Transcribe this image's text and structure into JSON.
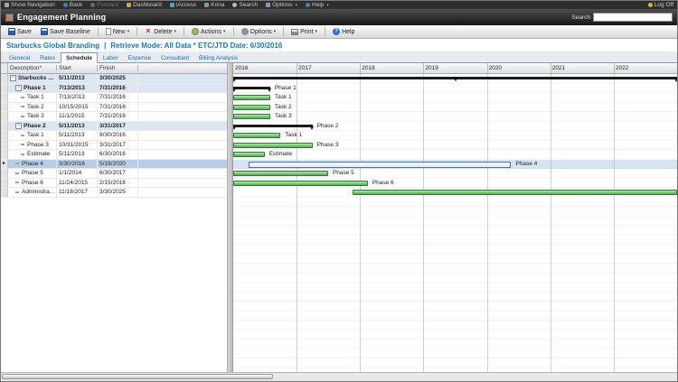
{
  "colors": {
    "accent_text": "#1b78a8",
    "summary_row_bg": "#dce6f3",
    "selection_bg": "#b7cde9",
    "bar_green_light": "#b9e3b3",
    "bar_green": "#53ab53",
    "bar_green_border": "#2e7a2e",
    "summary_bar": "#1a1a1a",
    "selected_bar_border": "#4a72a0",
    "selected_bar_fill": "#dfeaf4"
  },
  "utility_bar": {
    "items": [
      {
        "label": "Show Navigation",
        "icon": "show-navigation-icon",
        "disabled": false,
        "dropdown": false
      },
      {
        "label": "Back",
        "icon": "back-icon",
        "disabled": false,
        "dropdown": false
      },
      {
        "label": "Forward",
        "icon": "forward-icon",
        "disabled": true,
        "dropdown": false
      },
      {
        "label": "Dashboard",
        "icon": "dashboard-icon",
        "disabled": false,
        "dropdown": false
      },
      {
        "label": "iAccess",
        "icon": "iaccess-icon",
        "disabled": false,
        "dropdown": false
      },
      {
        "label": "Kona",
        "icon": "kona-icon",
        "disabled": false,
        "dropdown": false
      },
      {
        "label": "Search",
        "icon": "search-glyph-icon",
        "disabled": false,
        "dropdown": false
      },
      {
        "label": "Options",
        "icon": "options-icon",
        "disabled": false,
        "dropdown": true
      },
      {
        "label": "Help",
        "icon": "help-icon",
        "disabled": false,
        "dropdown": true
      }
    ],
    "log_off_label": "Log Off"
  },
  "title_bar": {
    "title": "Engagement Planning",
    "search_label": "Search",
    "search_value": ""
  },
  "toolbar": {
    "buttons": [
      {
        "label": "Save",
        "icon": "save-icon",
        "dropdown": false,
        "group_end": false
      },
      {
        "label": "Save Baseline",
        "icon": "save-baseline-icon",
        "dropdown": false,
        "group_end": true
      },
      {
        "label": "New",
        "icon": "new-icon",
        "dropdown": true,
        "group_end": true
      },
      {
        "label": "Delete",
        "icon": "delete-icon",
        "dropdown": true,
        "group_end": true
      },
      {
        "label": "Actions",
        "icon": "actions-icon",
        "dropdown": true,
        "group_end": true
      },
      {
        "label": "Options",
        "icon": "options-gear-icon",
        "dropdown": true,
        "group_end": true
      },
      {
        "label": "Print",
        "icon": "print-icon",
        "dropdown": true,
        "group_end": true
      },
      {
        "label": "Help",
        "icon": "help-circle-icon",
        "dropdown": false,
        "group_end": false
      }
    ]
  },
  "info_bar": {
    "project_name": "Starbucks Global Branding",
    "separator": "|",
    "retrieve_mode": "Retrieve Mode: All Data * ETC/JTD Date: 6/30/2016"
  },
  "tabs": {
    "selected": "Schedule",
    "items": [
      "General",
      "Rates",
      "Schedule",
      "Labor",
      "Expense",
      "Consultant",
      "Billing Analysis"
    ]
  },
  "grid": {
    "columns": [
      "Description*",
      "Start",
      "Finish"
    ],
    "rows": [
      {
        "indent": 0,
        "toggle": "-",
        "name": "Starbucks Glob...",
        "start": "5/11/2013",
        "finish": "3/30/2025",
        "style": "summary",
        "bar": "summary",
        "bar_label": "",
        "selected": false
      },
      {
        "indent": 1,
        "toggle": "-",
        "name": "Phase 1",
        "start": "7/13/2013",
        "finish": "7/31/2016",
        "style": "summary",
        "bar": "summary",
        "bar_label": "Phase 1",
        "selected": false
      },
      {
        "indent": 2,
        "toggle": "",
        "name": "Task 1",
        "start": "7/13/2013",
        "finish": "7/31/2016",
        "style": "normal",
        "bar": "task",
        "bar_label": "Task 1",
        "selected": false
      },
      {
        "indent": 2,
        "toggle": "",
        "name": "Task 2",
        "start": "10/15/2015",
        "finish": "7/31/2016",
        "style": "normal",
        "bar": "task",
        "bar_label": "Task 2",
        "selected": false
      },
      {
        "indent": 2,
        "toggle": "",
        "name": "Task 3",
        "start": "11/1/2015",
        "finish": "7/31/2016",
        "style": "normal",
        "bar": "task",
        "bar_label": "Task 3",
        "selected": false
      },
      {
        "indent": 1,
        "toggle": "-",
        "name": "Phase 2",
        "start": "5/11/2013",
        "finish": "3/31/2017",
        "style": "summary",
        "bar": "summary",
        "bar_label": "Phase 2",
        "selected": false
      },
      {
        "indent": 2,
        "toggle": "",
        "name": "Task 1",
        "start": "5/11/2013",
        "finish": "9/30/2016",
        "style": "normal",
        "bar": "task",
        "bar_label": "Task 1",
        "selected": false
      },
      {
        "indent": 2,
        "toggle": "",
        "name": "Phase 3",
        "start": "10/31/2015",
        "finish": "3/31/2017",
        "style": "normal",
        "bar": "task",
        "bar_label": "Phase 3",
        "selected": false
      },
      {
        "indent": 2,
        "toggle": "",
        "name": "Estimate",
        "start": "5/11/2013",
        "finish": "6/30/2016",
        "style": "normal",
        "bar": "task",
        "bar_label": "Estimate",
        "selected": false
      },
      {
        "indent": 1,
        "toggle": "",
        "name": "Phase 4",
        "start": "3/30/2016",
        "finish": "5/19/2020",
        "style": "selected",
        "bar": "selected",
        "bar_label": "Phase 4",
        "selected": true
      },
      {
        "indent": 1,
        "toggle": "",
        "name": "Phase 5",
        "start": "1/1/2014",
        "finish": "6/30/2017",
        "style": "normal",
        "bar": "task",
        "bar_label": "Phase 5",
        "selected": false
      },
      {
        "indent": 1,
        "toggle": "",
        "name": "Phase 6",
        "start": "11/24/2015",
        "finish": "2/15/2018",
        "style": "normal",
        "bar": "task",
        "bar_label": "Phase 6",
        "selected": false
      },
      {
        "indent": 1,
        "toggle": "",
        "name": "Administration",
        "start": "11/18/2017",
        "finish": "3/30/2025",
        "style": "normal",
        "bar": "task",
        "bar_label": "",
        "selected": false
      }
    ]
  },
  "chart_data": {
    "type": "gantt",
    "timeline_years": [
      "2016",
      "2017",
      "2018",
      "2019",
      "2020",
      "2021",
      "2022"
    ],
    "timeline_start_year": 2016,
    "timeline_span_years": 7,
    "marker": {
      "row": 0,
      "date": "7/1/2019"
    }
  }
}
